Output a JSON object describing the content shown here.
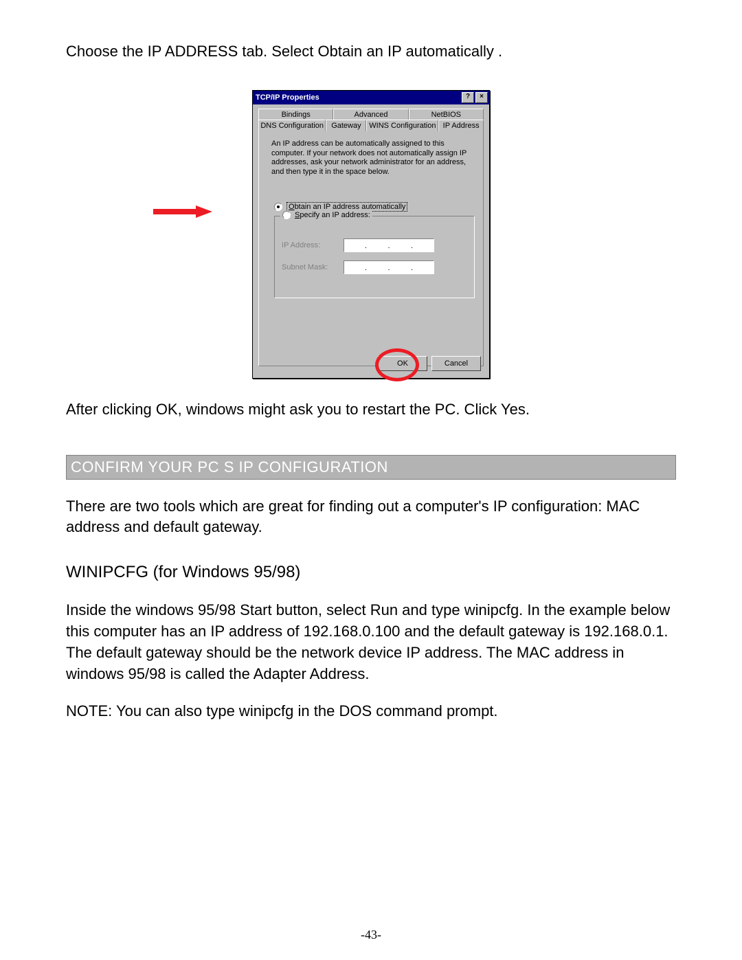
{
  "intro_text": "Choose the IP ADDRESS tab. Select Obtain an IP automatically   .",
  "dialog": {
    "title": "TCP/IP Properties",
    "help_btn": "?",
    "close_btn": "×",
    "tabs_row1": {
      "a": "Bindings",
      "b": "Advanced",
      "c": "NetBIOS"
    },
    "tabs_row2": {
      "a": "DNS Configuration",
      "b": "Gateway",
      "c": "WINS Configuration",
      "d": "IP Address"
    },
    "active_tab": "IP Address",
    "description": "An IP address can be automatically assigned to this computer. If your network does not automatically assign IP addresses, ask your network administrator for an address, and then type it in the space below.",
    "radio1_u": "O",
    "radio1_rest": "btain an IP address automatically",
    "radio1_checked": true,
    "radio2_u": "S",
    "radio2_rest": "pecify an IP address:",
    "radio2_checked": false,
    "field_ip_u": "I",
    "field_ip_rest": "P Address:",
    "field_mask_before": "S",
    "field_mask_u": "u",
    "field_mask_after": "bnet Mask:",
    "ok": "OK",
    "cancel": "Cancel"
  },
  "after_text": "After clicking OK, windows might ask you to restart the PC. Click Yes.",
  "section_title": "CONFIRM YOUR PC S IP CONFIGURATION",
  "para1": "There are two tools which are great for finding out a computer's IP configuration: MAC address and default gateway.",
  "subhead": "WINIPCFG (for Windows 95/98)",
  "para2": "Inside the windows 95/98 Start button, select Run and type winipcfg. In the example below this computer has an IP address of 192.168.0.100 and the default gateway is 192.168.0.1. The default gateway should be the network device IP address. The MAC address in windows 95/98 is called the Adapter Address.",
  "note": "NOTE: You can also type winipcfg  in the DOS command prompt.",
  "page_number": "-43-"
}
